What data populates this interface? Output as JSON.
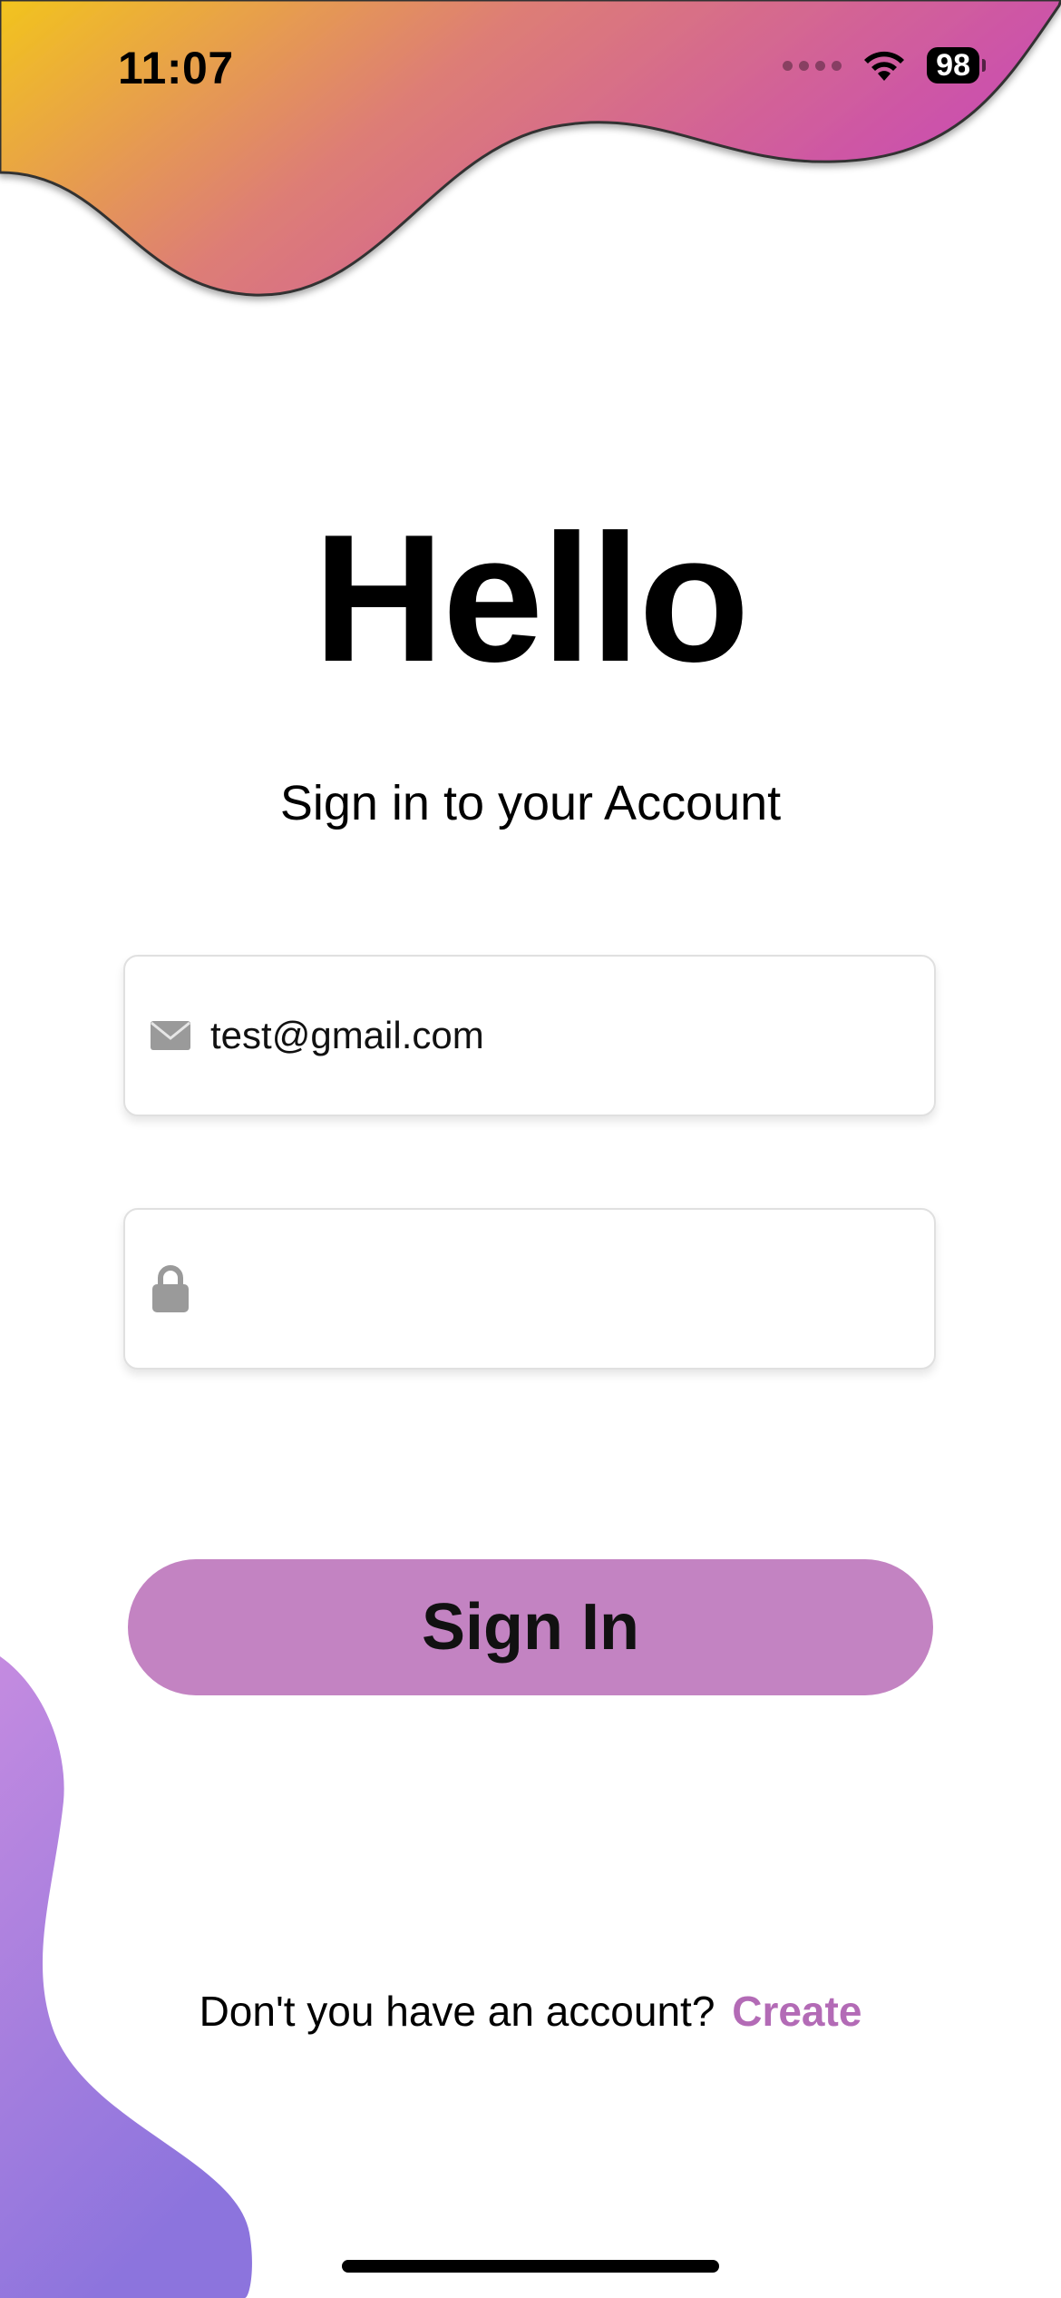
{
  "status_bar": {
    "time": "11:07",
    "battery": "98",
    "signal_icon": "cellular-signal-icon",
    "wifi_icon": "wifi-icon"
  },
  "heading": {
    "title": "Hello",
    "subtitle": "Sign in to your Account"
  },
  "form": {
    "email": {
      "value": "test@gmail.com",
      "icon": "envelope-icon"
    },
    "password": {
      "value": "",
      "icon": "lock-icon"
    },
    "submit_label": "Sign In"
  },
  "footer": {
    "prompt": "Don't you have an account?",
    "link_label": "Create"
  },
  "colors": {
    "accent": "#c383c2",
    "link": "#b36bb6",
    "wave_top_start": "#f2c41d",
    "wave_top_end": "#c94bb3",
    "wave_bottom_start": "#c48be0",
    "wave_bottom_end": "#8c74dd"
  }
}
